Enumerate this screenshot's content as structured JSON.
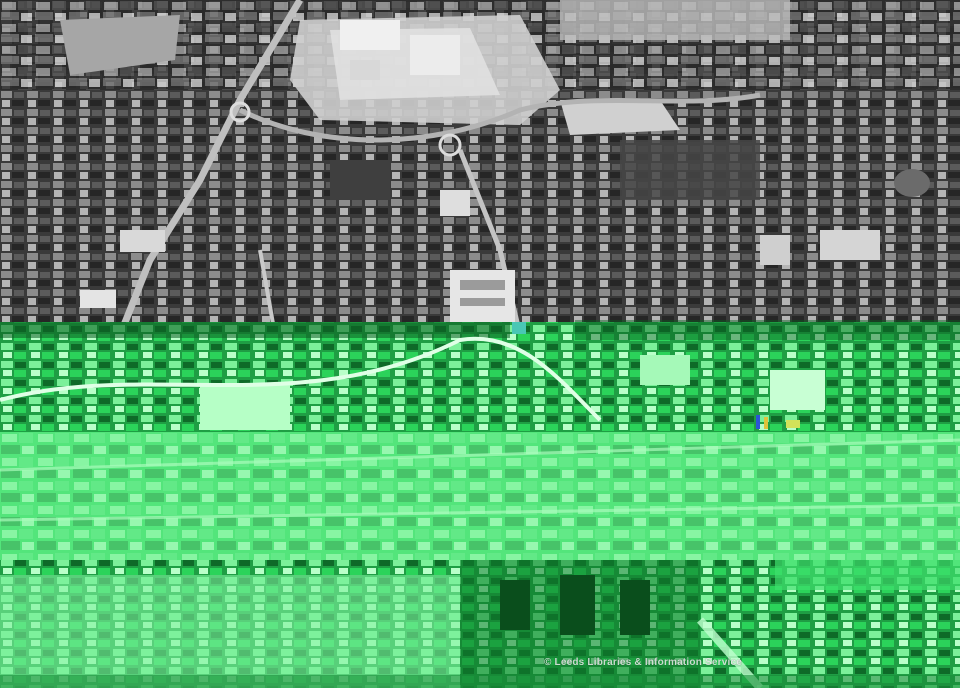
{
  "image": {
    "subject": "aerial-city-photograph",
    "credit": "© Leeds Libraries & Information Service",
    "colors": {
      "photo_dark": "#1f1f1f",
      "photo_mid": "#7a7a7a",
      "photo_light": "#d8d8d8",
      "glitch_green": "#2bd35a",
      "glitch_green_light": "#8ff5a6",
      "glitch_green_dark": "#0f7a2c"
    }
  }
}
